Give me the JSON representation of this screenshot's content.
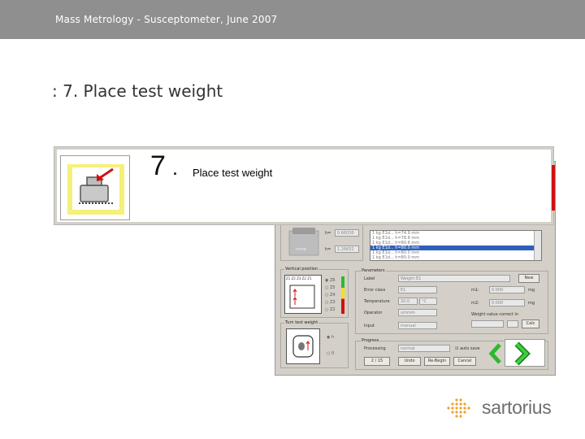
{
  "header": {
    "text": "Mass Metrology - Susceptometer, June 2007"
  },
  "slide": {
    "title": ": 7. Place test weight"
  },
  "instruction": {
    "number": "7",
    "dot": ".",
    "text": "Place test weight"
  },
  "app": {
    "weight_fields": [
      "0.66030",
      "1.26652"
    ],
    "weight_labels": [
      "h=",
      "h="
    ],
    "weight_caption": "mme",
    "list_rows": [
      "1 kg E1d... h=74.9 mm",
      "1 kg E1d... h=78.8 mm",
      "1 kg E1d... h=80.6 mm",
      "1 kg E1d... h=80.0 mm",
      "1 kg E1d... h=80.0 mm",
      "1 kg E1d... h=80.0 mm"
    ],
    "list_selected_index": 3,
    "vertical_position": {
      "title": "Vertical position",
      "header": "Z1 Z2 Z3 Z2 Z1",
      "options": [
        "Z6",
        "Z5",
        "Z4",
        "Z3",
        "Z2"
      ],
      "selected": "Z6"
    },
    "turn_test_weight": {
      "title": "Turn test weight",
      "options": [
        "h",
        "0"
      ],
      "selected": "h"
    },
    "parameters": {
      "title": "Parameters",
      "label_label": "Label",
      "label_value": "Weight E1",
      "new_button": "New",
      "error_class_label": "Error class",
      "error_class_value": "E1",
      "temperature_label": "Temperature",
      "temperature_value": "20.0",
      "temperature_unit": "°C",
      "operator_label": "Operator",
      "operator_value": "ummm",
      "input_label": "Input",
      "input_value": "manual",
      "m1_label": "m1:",
      "m1_value": "0.000",
      "m1_unit": "mg",
      "m2_label": "m2:",
      "m2_value": "0.000",
      "m2_unit": "mg",
      "weight_value_label": "Weight value correct in",
      "calc_button": "Calc"
    },
    "progress": {
      "title": "Progress",
      "processing_label": "Processing",
      "processing_value": "normal",
      "auto_label": "auto save",
      "step_counter": "2 / 15",
      "buttons": [
        "Undo",
        "Re-Begin",
        "Cancel"
      ]
    }
  },
  "logo": {
    "text": "sartorius"
  },
  "colors": {
    "header_bg": "#8f8f8f",
    "selection_blue": "#2f5fb8",
    "arrow_green": "#2db82d",
    "accent_red": "#d21010",
    "logo_orange": "#f0a030",
    "weight_box_yellow": "#f5f07a"
  },
  "icons": [
    "weight-placement-icon",
    "next-arrow-icon",
    "prev-arrow-icon",
    "sartorius-logo-icon"
  ]
}
